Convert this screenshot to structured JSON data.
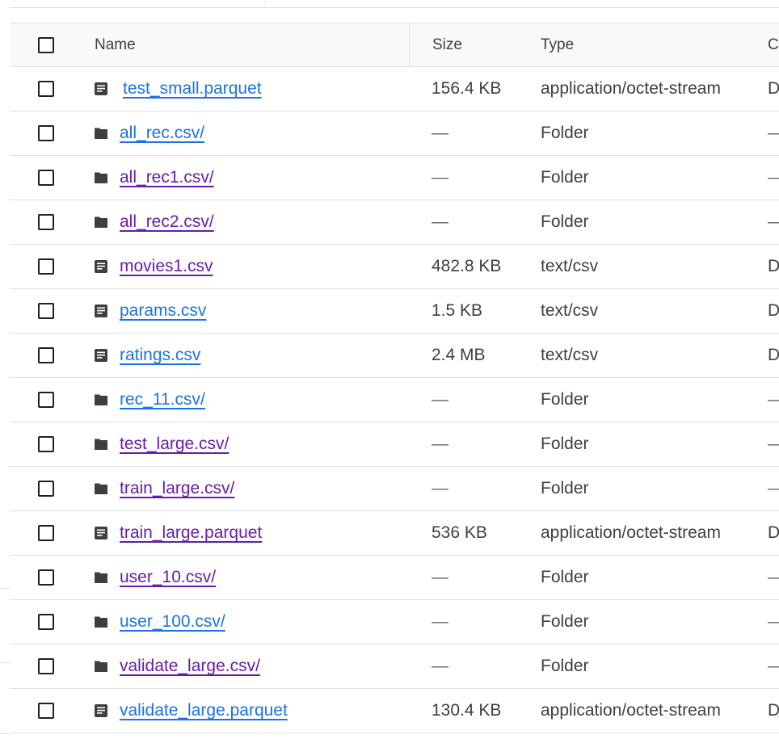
{
  "columns": {
    "check": "",
    "name": "Name",
    "size": "Size",
    "type": "Type",
    "created": "Cr"
  },
  "rows": [
    {
      "name": "test_small.parquet",
      "kind": "file",
      "size": "156.4 KB",
      "type": "application/octet-stream",
      "created": "D",
      "link": "unvisited"
    },
    {
      "name": "all_rec.csv/",
      "kind": "folder",
      "size": "—",
      "type": "Folder",
      "created": "—",
      "link": "unvisited"
    },
    {
      "name": "all_rec1.csv/",
      "kind": "folder",
      "size": "—",
      "type": "Folder",
      "created": "—",
      "link": "visited"
    },
    {
      "name": "all_rec2.csv/",
      "kind": "folder",
      "size": "—",
      "type": "Folder",
      "created": "—",
      "link": "visited"
    },
    {
      "name": "movies1.csv",
      "kind": "file",
      "size": "482.8 KB",
      "type": "text/csv",
      "created": "D",
      "link": "visited"
    },
    {
      "name": "params.csv",
      "kind": "file",
      "size": "1.5 KB",
      "type": "text/csv",
      "created": "D",
      "link": "unvisited"
    },
    {
      "name": "ratings.csv",
      "kind": "file",
      "size": "2.4 MB",
      "type": "text/csv",
      "created": "D",
      "link": "unvisited"
    },
    {
      "name": "rec_11.csv/",
      "kind": "folder",
      "size": "—",
      "type": "Folder",
      "created": "—",
      "link": "unvisited"
    },
    {
      "name": "test_large.csv/",
      "kind": "folder",
      "size": "—",
      "type": "Folder",
      "created": "—",
      "link": "visited"
    },
    {
      "name": "train_large.csv/",
      "kind": "folder",
      "size": "—",
      "type": "Folder",
      "created": "—",
      "link": "visited"
    },
    {
      "name": "train_large.parquet",
      "kind": "file",
      "size": "536 KB",
      "type": "application/octet-stream",
      "created": "D",
      "link": "visited"
    },
    {
      "name": "user_10.csv/",
      "kind": "folder",
      "size": "—",
      "type": "Folder",
      "created": "—",
      "link": "visited"
    },
    {
      "name": "user_100.csv/",
      "kind": "folder",
      "size": "—",
      "type": "Folder",
      "created": "—",
      "link": "unvisited"
    },
    {
      "name": "validate_large.csv/",
      "kind": "folder",
      "size": "—",
      "type": "Folder",
      "created": "—",
      "link": "visited"
    },
    {
      "name": "validate_large.parquet",
      "kind": "file",
      "size": "130.4 KB",
      "type": "application/octet-stream",
      "created": "D",
      "link": "unvisited"
    }
  ],
  "colors": {
    "link_visited": "#681da8",
    "link_unvisited": "#1a73e8",
    "icon": "#3c4043",
    "divider": "#e0e0e0"
  },
  "icons": {
    "file": "document-icon",
    "folder": "folder-icon"
  }
}
